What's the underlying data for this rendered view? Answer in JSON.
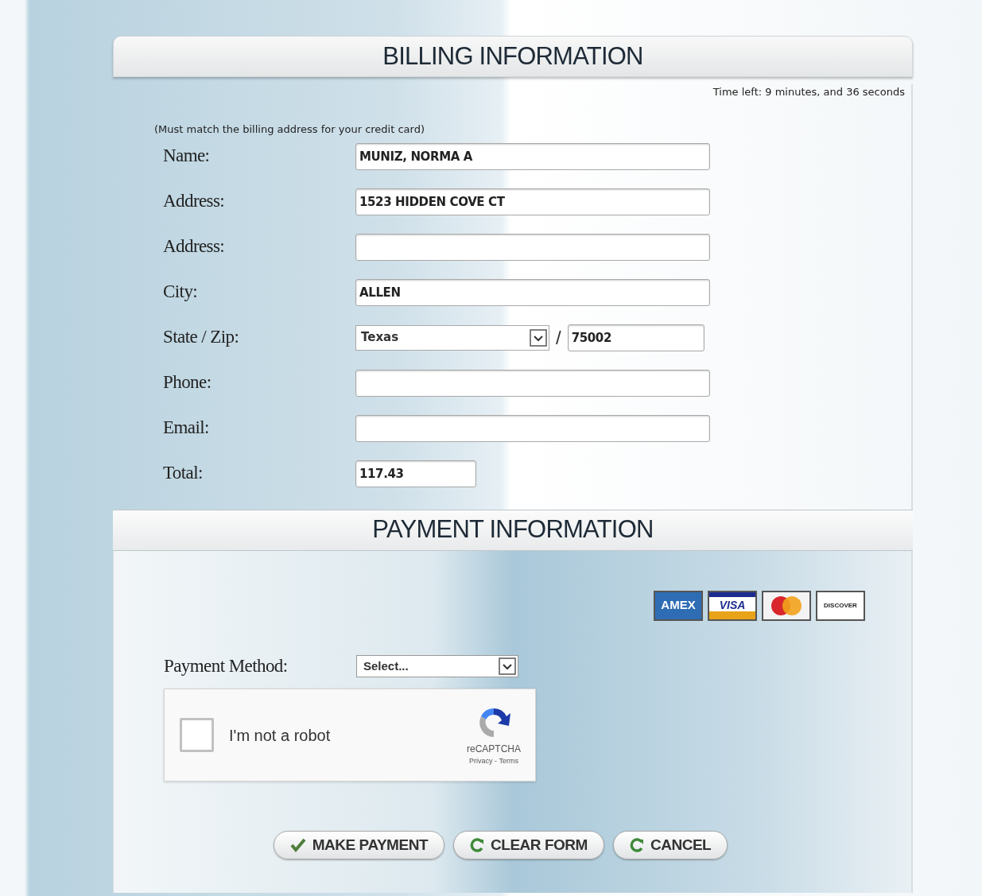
{
  "billing": {
    "title": "BILLING INFORMATION",
    "timer": "Time left: 9 minutes, and 36 seconds",
    "note": "(Must match the billing address for your credit card)",
    "fields": [
      {
        "kind": "text",
        "label": "Name:",
        "value": "MUNIZ, NORMA A"
      },
      {
        "kind": "text",
        "label": "Address:",
        "value": "1523 HIDDEN COVE CT"
      },
      {
        "kind": "text",
        "label": "Address:"
      },
      {
        "kind": "text",
        "label": "City:",
        "value": "ALLEN"
      },
      {
        "kind": "state_zip",
        "label": "State / Zip:",
        "value": "Texas",
        "separator": "/",
        "zip": "75002"
      },
      {
        "kind": "text",
        "label": "Phone:"
      },
      {
        "kind": "text",
        "label": "Email:"
      },
      {
        "kind": "total",
        "label": "Total:",
        "value": "117.43"
      }
    ]
  },
  "payment": {
    "title": "PAYMENT INFORMATION",
    "cards": [
      {
        "kind": "amex",
        "label": "AMEX"
      },
      {
        "kind": "visa",
        "label": "VISA"
      },
      {
        "kind": "mastercard"
      },
      {
        "kind": "discover",
        "label": "DISCOVER"
      }
    ],
    "method": {
      "label": "Payment Method:",
      "value": "Select..."
    },
    "captcha": {
      "checked": false,
      "label": "I'm not a robot",
      "brand": "reCAPTCHA",
      "links": "Privacy - Terms"
    }
  },
  "buttons": [
    {
      "kind": "check",
      "label": "MAKE PAYMENT"
    },
    {
      "kind": "reset",
      "label": "CLEAR FORM"
    },
    {
      "kind": "reset",
      "label": "CANCEL"
    }
  ]
}
